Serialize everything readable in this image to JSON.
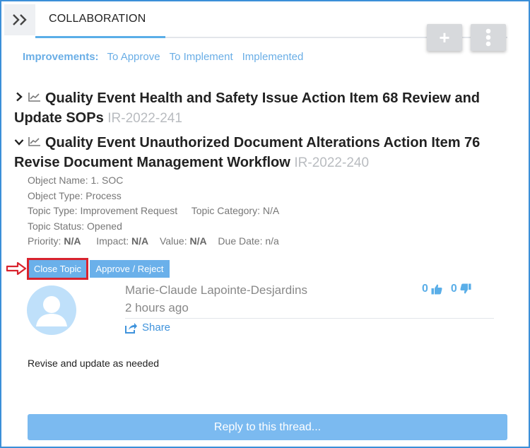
{
  "header": {
    "tab_label": "COLLABORATION",
    "add_label": "+"
  },
  "filters": {
    "label": "Improvements:",
    "links": [
      "To Approve",
      "To Implement",
      "Implemented"
    ]
  },
  "topics": [
    {
      "title": "Quality Event Health and Safety Issue Action Item 68 Review and Update SOPs",
      "code": "IR-2022-241",
      "expanded": false
    },
    {
      "title": "Quality Event Unauthorized Document Alterations Action Item 76 Revise Document Management Workflow",
      "code": "IR-2022-240",
      "expanded": true,
      "details": {
        "object_name": "Object Name: 1. SOC",
        "object_type": "Object Type: Process",
        "topic_type": "Topic Type: Improvement Request",
        "topic_category": "Topic Category: N/A",
        "topic_status": "Topic Status: Opened",
        "priority_label": "Priority:",
        "priority_value": "N/A",
        "impact_label": "Impact:",
        "impact_value": "N/A",
        "value_label": "Value:",
        "value_value": "N/A",
        "due_date": "Due Date: n/a"
      }
    }
  ],
  "actions": {
    "close_topic": "Close Topic",
    "approve_reject": "Approve / Reject"
  },
  "comment": {
    "author": "Marie-Claude Lapointe-Desjardins",
    "time": "2 hours ago",
    "share_label": "Share",
    "upvotes": "0",
    "downvotes": "0",
    "text": "Revise and update as needed"
  },
  "reply_label": "Reply to this thread...",
  "colors": {
    "accent": "#5aaee8",
    "highlight": "#d9232e",
    "frame": "#3a8fd8"
  }
}
